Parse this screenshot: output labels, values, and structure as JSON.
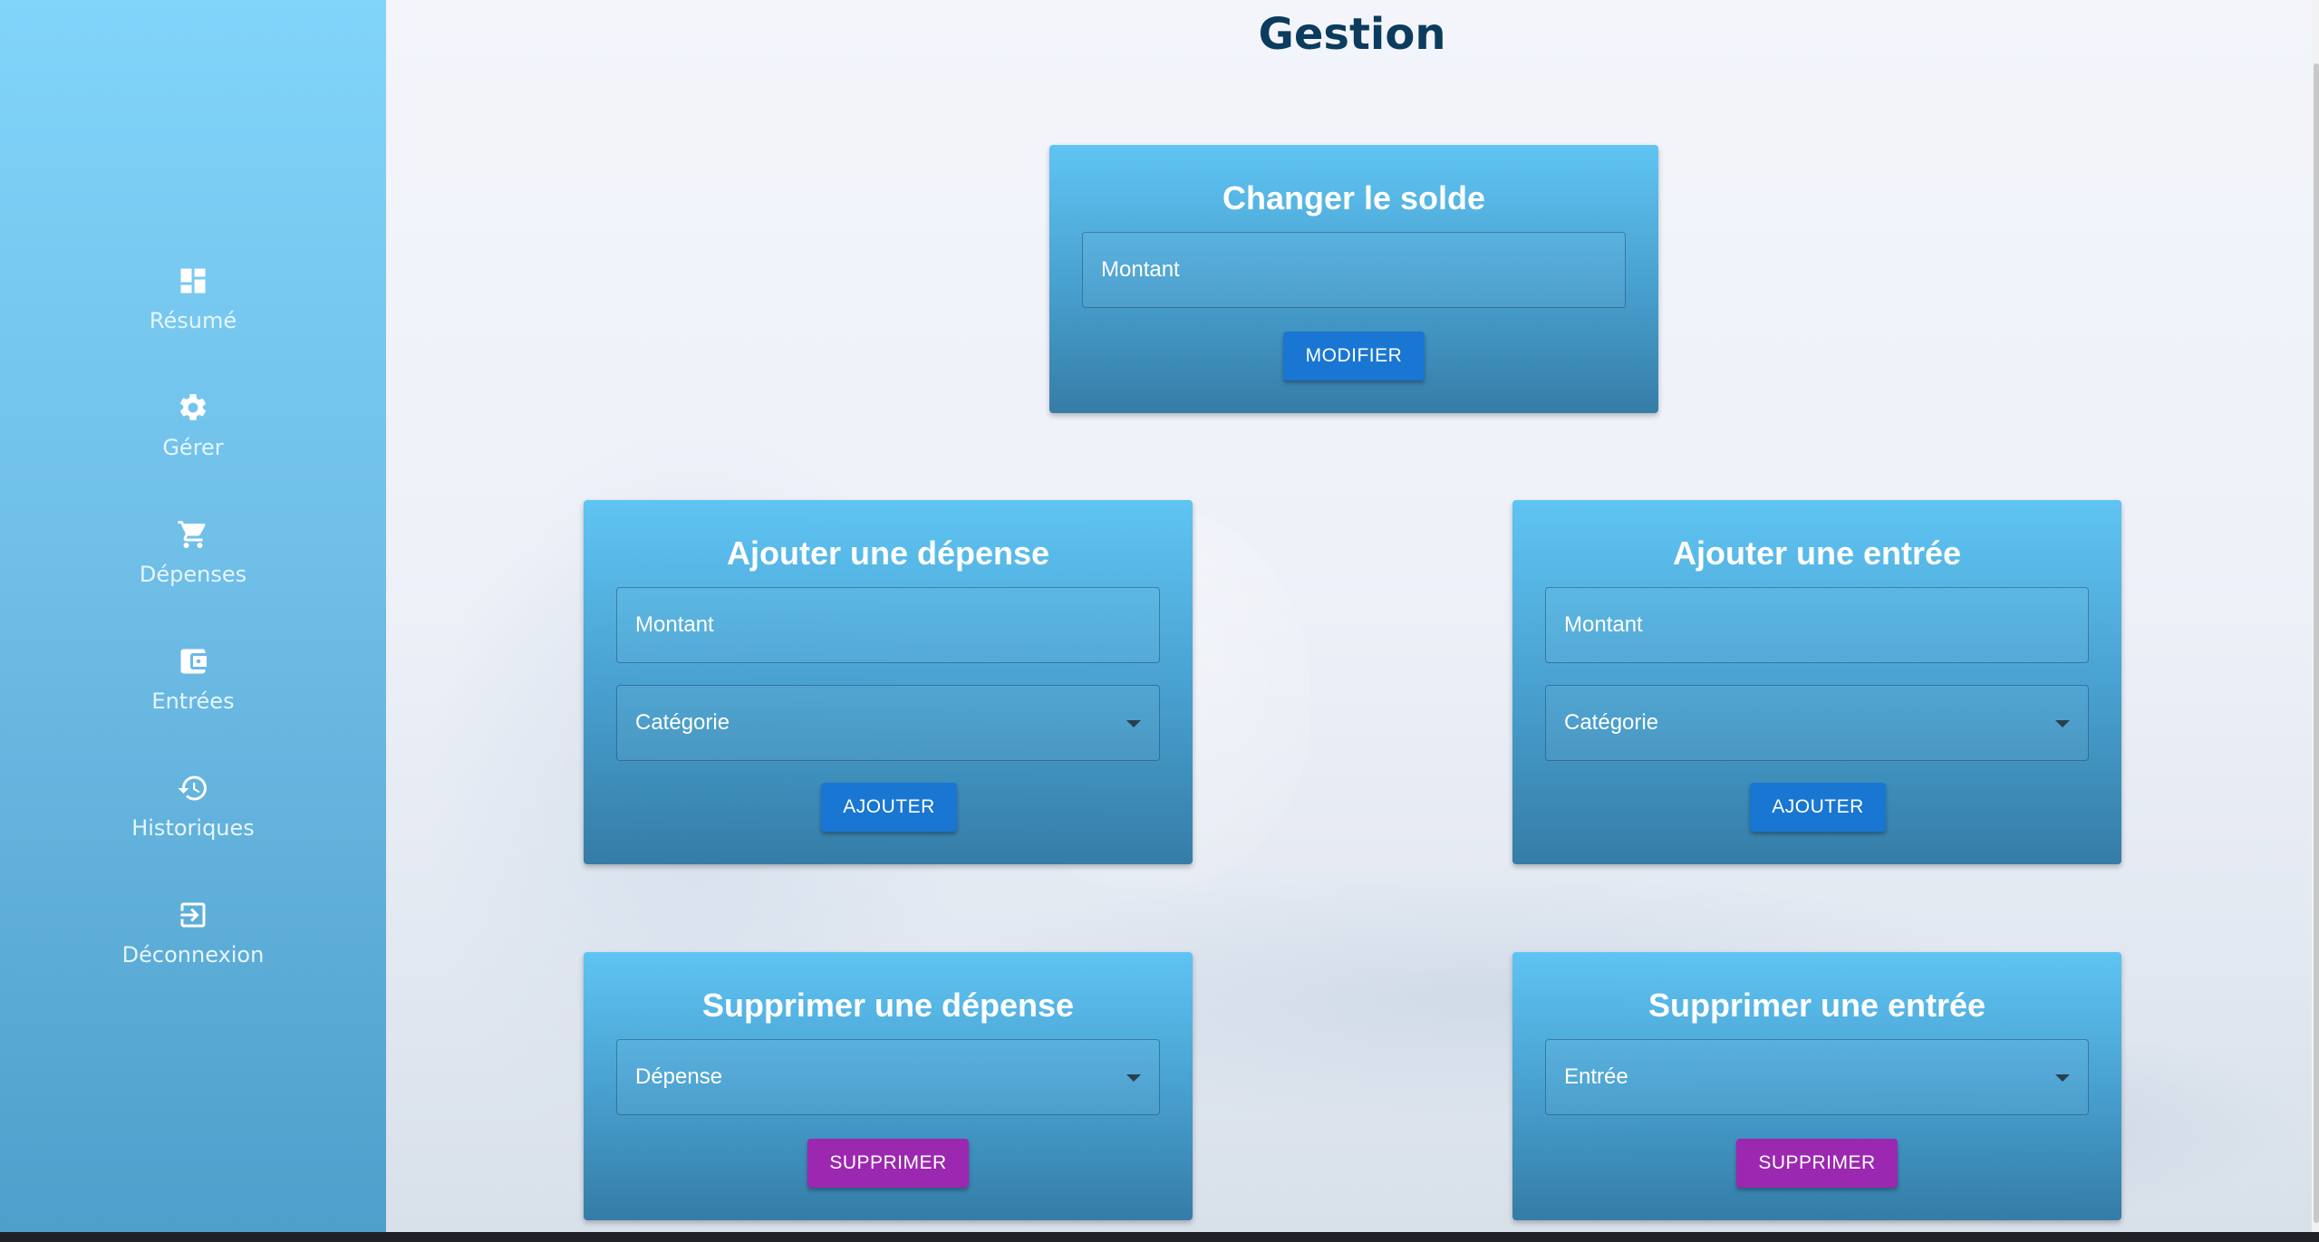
{
  "sidebar": {
    "items": [
      {
        "label": "Résumé",
        "icon": "dashboard-icon"
      },
      {
        "label": "Gérer",
        "icon": "gear-icon"
      },
      {
        "label": "Dépenses",
        "icon": "cart-icon"
      },
      {
        "label": "Entrées",
        "icon": "wallet-icon"
      },
      {
        "label": "Historiques",
        "icon": "history-icon"
      },
      {
        "label": "Déconnexion",
        "icon": "logout-icon"
      }
    ]
  },
  "page": {
    "title": "Gestion"
  },
  "cards": {
    "change_balance": {
      "title": "Changer le solde",
      "amount_placeholder": "Montant",
      "button": "MODIFIER"
    },
    "add_expense": {
      "title": "Ajouter une dépense",
      "amount_placeholder": "Montant",
      "category_placeholder": "Catégorie",
      "button": "AJOUTER"
    },
    "add_income": {
      "title": "Ajouter une entrée",
      "amount_placeholder": "Montant",
      "category_placeholder": "Catégorie",
      "button": "AJOUTER"
    },
    "delete_expense": {
      "title": "Supprimer une dépense",
      "select_placeholder": "Dépense",
      "button": "SUPPRIMER"
    },
    "delete_income": {
      "title": "Supprimer une entrée",
      "select_placeholder": "Entrée",
      "button": "SUPPRIMER"
    }
  },
  "colors": {
    "sidebar_top": "#81d4fa",
    "card": "#4fb3e8",
    "primary_button": "#1976d2",
    "delete_button": "#9c27b0",
    "title": "#0b3c5d"
  }
}
